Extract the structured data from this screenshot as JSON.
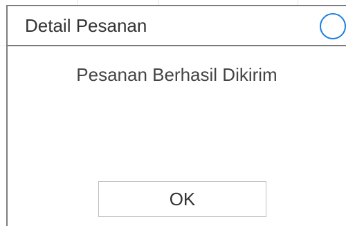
{
  "dialog": {
    "title": "Detail Pesanan",
    "message": "Pesanan Berhasil Dikirim",
    "ok_label": "OK",
    "close_icon": "circle-close-icon"
  },
  "colors": {
    "border": "#7d7d7d",
    "close_accent": "#1a7fe3",
    "text": "#333333",
    "button_border": "#bdbdbd"
  }
}
